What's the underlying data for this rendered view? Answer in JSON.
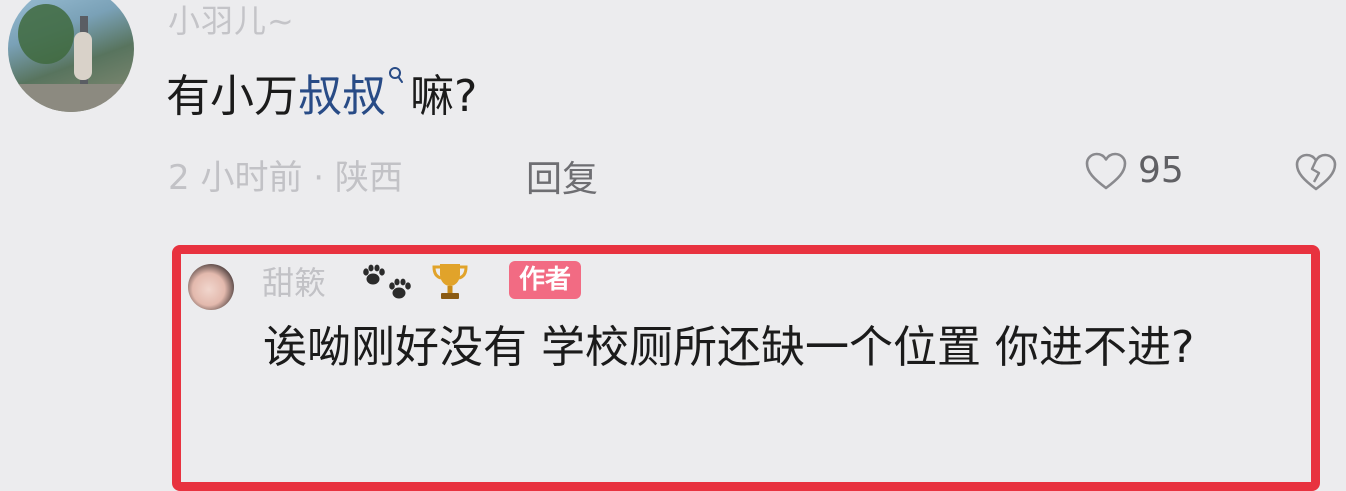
{
  "comment": {
    "username": "小羽儿~",
    "text_before": "有小万",
    "link_text": "叔叔",
    "text_after": "嘛?",
    "meta": "2 小时前 · 陕西",
    "reply_label": "回复",
    "like_count": "95"
  },
  "reply": {
    "username": "甜簌",
    "badge": "作者",
    "text": "诶呦刚好没有 学校厕所还缺一个位置 你进不进?"
  },
  "colors": {
    "highlight": "#e8323f",
    "link": "#284b86",
    "badge_bg": "#f26b83"
  },
  "icons": {
    "search": "search-icon",
    "like": "heart-icon",
    "dislike": "broken-heart-icon",
    "paw": "paw-icon",
    "trophy": "trophy-icon"
  }
}
